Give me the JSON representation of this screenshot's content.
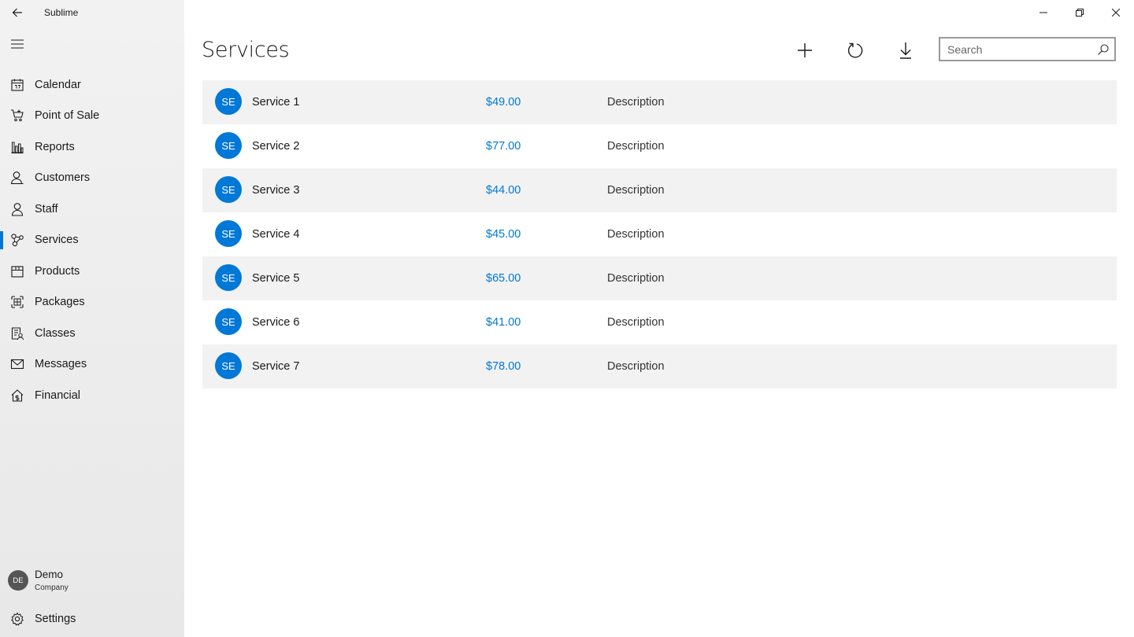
{
  "app": {
    "title": "Sublime"
  },
  "sidebar": {
    "items": [
      {
        "label": "Calendar",
        "icon": "calendar-icon",
        "active": false
      },
      {
        "label": "Point of Sale",
        "icon": "cart-icon",
        "active": false
      },
      {
        "label": "Reports",
        "icon": "chart-icon",
        "active": false
      },
      {
        "label": "Customers",
        "icon": "customers-icon",
        "active": false
      },
      {
        "label": "Staff",
        "icon": "person-icon",
        "active": false
      },
      {
        "label": "Services",
        "icon": "services-icon",
        "active": true
      },
      {
        "label": "Products",
        "icon": "box-icon",
        "active": false
      },
      {
        "label": "Packages",
        "icon": "packages-icon",
        "active": false
      },
      {
        "label": "Classes",
        "icon": "classes-icon",
        "active": false
      },
      {
        "label": "Messages",
        "icon": "mail-icon",
        "active": false
      },
      {
        "label": "Financial",
        "icon": "financial-icon",
        "active": false
      }
    ],
    "profile": {
      "initials": "DE",
      "name": "Demo",
      "company": "Company"
    },
    "settings_label": "Settings"
  },
  "main": {
    "title": "Services",
    "search": {
      "placeholder": "Search",
      "value": ""
    },
    "rows": [
      {
        "initials": "SE",
        "name": "Service 1",
        "price": "$49.00",
        "description": "Description"
      },
      {
        "initials": "SE",
        "name": "Service 2",
        "price": "$77.00",
        "description": "Description"
      },
      {
        "initials": "SE",
        "name": "Service 3",
        "price": "$44.00",
        "description": "Description"
      },
      {
        "initials": "SE",
        "name": "Service 4",
        "price": "$45.00",
        "description": "Description"
      },
      {
        "initials": "SE",
        "name": "Service 5",
        "price": "$65.00",
        "description": "Description"
      },
      {
        "initials": "SE",
        "name": "Service 6",
        "price": "$41.00",
        "description": "Description"
      },
      {
        "initials": "SE",
        "name": "Service 7",
        "price": "$78.00",
        "description": "Description"
      }
    ]
  },
  "colors": {
    "accent": "#0078d7",
    "row_alt": "#f2f2f2",
    "sidebar": "#ededed"
  }
}
